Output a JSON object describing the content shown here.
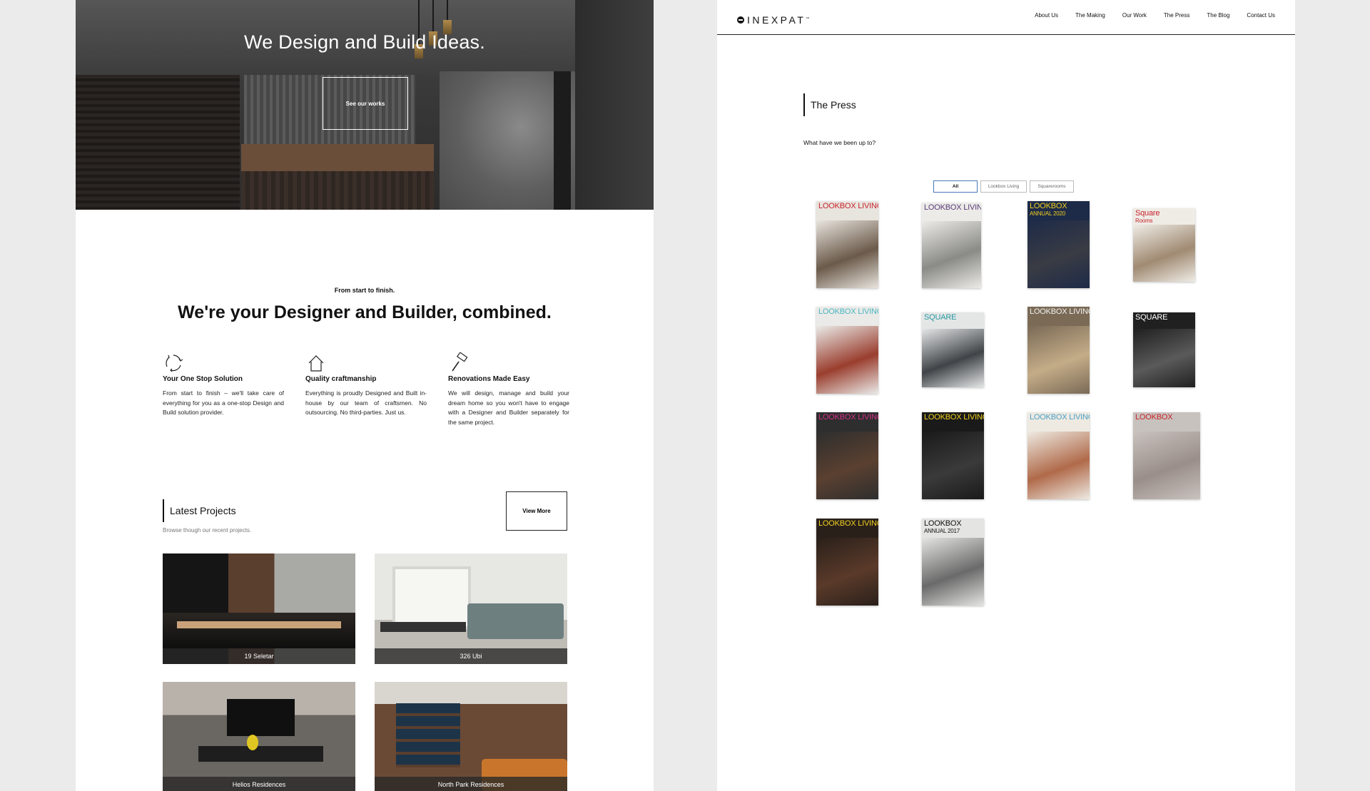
{
  "left_page": {
    "hero": {
      "title": "We Design and Build Ideas.",
      "button_label": "See our works"
    },
    "intro": {
      "eyebrow": "From start to finish.",
      "heading": "We're your Designer and Builder, combined."
    },
    "features": [
      {
        "icon": "recycle-icon",
        "title": "Your One Stop Solution",
        "text": "From start to finish – we'll take care of everything for you as a one-stop Design and Build solution provider."
      },
      {
        "icon": "house-icon",
        "title": "Quality craftmanship",
        "text": "Everything is proudly Designed and Built in-house by our team of craftsmen. No outsourcing. No third-parties. Just us."
      },
      {
        "icon": "paint-roller-icon",
        "title": "Renovations Made Easy",
        "text": "We will design, manage and build your dream home so you won't have to engage with a Designer and Builder separately for the same project."
      }
    ],
    "latest": {
      "title": "Latest Projects",
      "subtitle": "Browse though our recent projects.",
      "view_more": "View More",
      "projects": [
        "19 Seletar",
        "326 Ubi",
        "Helios Residences",
        "North Park Residences"
      ]
    }
  },
  "right_page": {
    "logo": {
      "text": "INEXPAT",
      "tm": "™"
    },
    "nav": [
      "About Us",
      "The Making",
      "Our Work",
      "The Press",
      "The Blog",
      "Contact Us"
    ],
    "press": {
      "title": "The Press",
      "subtitle": "What have we been up to?",
      "filters": [
        "All",
        "Lookbox Living",
        "Squarerooms"
      ],
      "active_filter": "All"
    },
    "covers": [
      {
        "mast": "LOOKBOX LIVING",
        "mast_color": "#c8242c",
        "bg": "#e8e4de",
        "img": "#6b5a4a"
      },
      {
        "mast": "LOOKBOX LIVING",
        "mast_color": "#5a3d7a",
        "bg": "#ecebe8",
        "img": "#8a8a86"
      },
      {
        "mast": "LOOKBOX",
        "sub": "ANNUAL 2020",
        "mast_color": "#f0d020",
        "bg": "#1d2a48",
        "img": "#3a3c44"
      },
      {
        "mast": "Square",
        "sub": "Rooms",
        "mast_color": "#c8242c",
        "bg": "#efece6",
        "img": "#a08a72"
      },
      {
        "mast": "LOOKBOX LIVING",
        "mast_color": "#49b6c0",
        "bg": "#eaeae8",
        "img": "#9a3e2e"
      },
      {
        "mast": "SQUARE",
        "mast_color": "#2a9aa0",
        "bg": "#e4e6e6",
        "img": "#404448"
      },
      {
        "mast": "LOOKBOX LIVING",
        "mast_color": "#f2f2f2",
        "bg": "#7a6a56",
        "img": "#c4ac88"
      },
      {
        "mast": "SQUARE",
        "mast_color": "#ffffff",
        "bg": "#202020",
        "img": "#5a5a5a"
      },
      {
        "mast": "LOOKBOX LIVING",
        "mast_color": "#d22e8a",
        "bg": "#2e2e2e",
        "img": "#5a4030"
      },
      {
        "mast": "LOOKBOX LIVING",
        "mast_color": "#f0d020",
        "bg": "#1a1a1a",
        "img": "#3a3a3a"
      },
      {
        "mast": "LOOKBOX LIVING",
        "mast_color": "#4aa0c8",
        "bg": "#eeeae2",
        "img": "#b06a4a"
      },
      {
        "mast": "LOOKBOX",
        "mast_color": "#c8242c",
        "bg": "#c8c2be",
        "img": "#9a8e8a"
      },
      {
        "mast": "LOOKBOX LIVING",
        "mast_color": "#f0d020",
        "bg": "#2a201a",
        "img": "#5a3a2a"
      },
      {
        "mast": "LOOKBOX",
        "sub": "ANNUAL 2017",
        "mast_color": "#111111",
        "bg": "#e4e4e2",
        "img": "#6a6a6a"
      }
    ]
  }
}
